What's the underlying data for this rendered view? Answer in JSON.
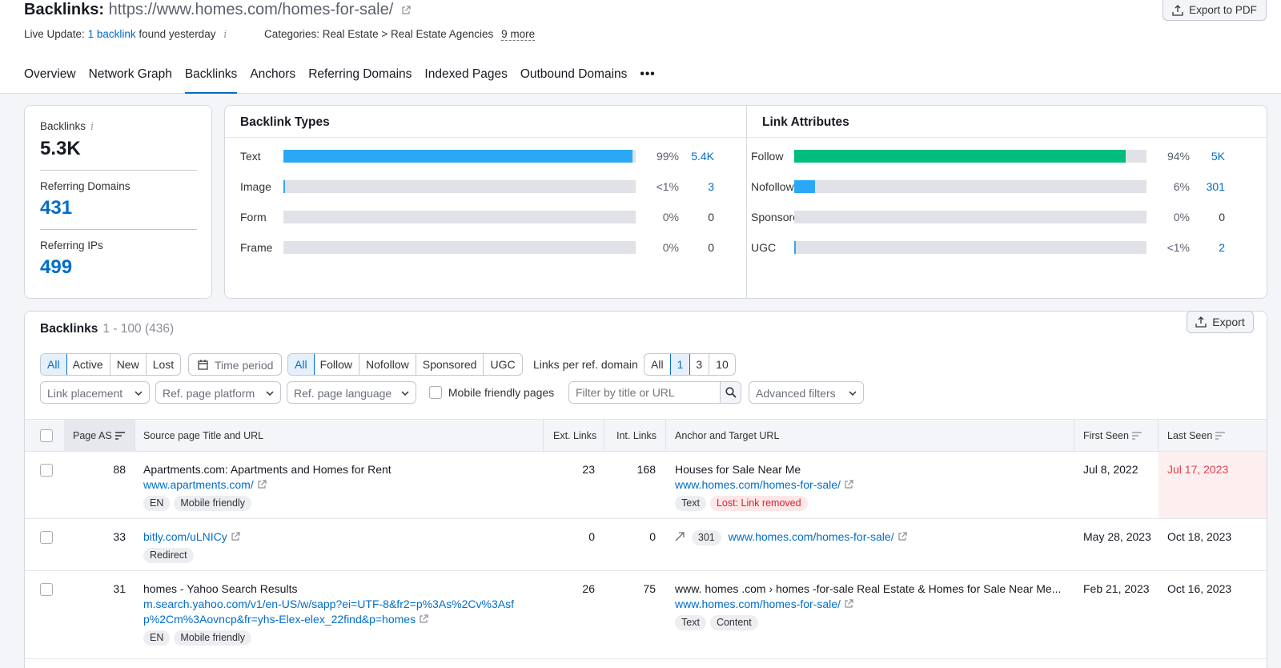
{
  "header": {
    "title_prefix": "Backlinks:",
    "title_url": "https://www.homes.com/homes-for-sale/",
    "live_label": "Live Update:",
    "live_link": "1 backlink",
    "live_suffix": "found yesterday",
    "categories_label": "Categories: Real Estate > Real Estate Agencies",
    "categories_more": "9 more",
    "export_pdf": "Export to PDF"
  },
  "tabs": [
    "Overview",
    "Network Graph",
    "Backlinks",
    "Anchors",
    "Referring Domains",
    "Indexed Pages",
    "Outbound Domains"
  ],
  "tabs_more": "•••",
  "stats": [
    {
      "label": "Backlinks",
      "value": "5.3K"
    },
    {
      "label": "Referring Domains",
      "value": "431"
    },
    {
      "label": "Referring IPs",
      "value": "499"
    }
  ],
  "backlink_types": {
    "title": "Backlink Types",
    "color": "#2ba8f5",
    "rows": [
      {
        "name": "Text",
        "fraction": 0.99,
        "pct": "99%",
        "count": "5.4K"
      },
      {
        "name": "Image",
        "fraction": 0.004,
        "pct": "<1%",
        "count": "3"
      },
      {
        "name": "Form",
        "fraction": 0,
        "pct": "0%",
        "count": "0"
      },
      {
        "name": "Frame",
        "fraction": 0,
        "pct": "0%",
        "count": "0"
      }
    ]
  },
  "link_attributes": {
    "title": "Link Attributes",
    "colors": {
      "follow": "#00bd7e",
      "other": "#2ba8f5"
    },
    "rows": [
      {
        "name": "Follow",
        "fraction": 0.94,
        "pct": "94%",
        "count": "5K"
      },
      {
        "name": "Nofollow",
        "fraction": 0.06,
        "pct": "6%",
        "count": "301"
      },
      {
        "name": "Sponsored",
        "fraction": 0,
        "pct": "0%",
        "count": "0"
      },
      {
        "name": "UGC",
        "fraction": 0.004,
        "pct": "<1%",
        "count": "2"
      }
    ]
  },
  "backlinks": {
    "title": "Backlinks",
    "range": "1 - 100 (436)",
    "export": "Export",
    "status_filter": [
      "All",
      "Active",
      "New",
      "Lost"
    ],
    "time_period": "Time period",
    "type_filter": [
      "All",
      "Follow",
      "Nofollow",
      "Sponsored",
      "UGC"
    ],
    "per_domain_label": "Links per ref. domain",
    "per_domain": [
      "All",
      "1",
      "3",
      "10"
    ],
    "link_placement": "Link placement",
    "ref_platform": "Ref. page platform",
    "ref_language": "Ref. page language",
    "mobile_friendly": "Mobile friendly pages",
    "search_placeholder": "Filter by title or URL",
    "advanced": "Advanced filters",
    "columns": {
      "page_as": "Page AS",
      "source": "Source page Title and URL",
      "ext": "Ext. Links",
      "int": "Int. Links",
      "anchor": "Anchor and Target URL",
      "first": "First Seen",
      "last": "Last Seen"
    },
    "rows": [
      {
        "as": "88",
        "title": "Apartments.com: Apartments and Homes for Rent",
        "url": "www.apartments.com/",
        "tags": [
          "EN",
          "Mobile friendly"
        ],
        "ext": "23",
        "int": "168",
        "anchor": "Houses for Sale Near Me",
        "target": "www.homes.com/homes-for-sale/",
        "anchor_tags": [
          "Text"
        ],
        "anchor_alert": "Lost: Link removed",
        "first": "Jul 8, 2022",
        "last": "Jul 17, 2023"
      },
      {
        "as": "33",
        "url": "bitly.com/uLNICy",
        "tags": [
          "Redirect"
        ],
        "ext": "0",
        "int": "0",
        "redirect_code": "301",
        "target": "www.homes.com/homes-for-sale/",
        "first": "May 28, 2023",
        "last": "Oct 18, 2023"
      },
      {
        "as": "31",
        "title": "homes - Yahoo Search Results",
        "url_line1": "m.search.yahoo.com/v1/en-US/w/sapp?ei=UTF-8&fr2=p%3As%2Cv%3Asf",
        "url_line2": "p%2Cm%3Aovncp&fr=yhs-Elex-elex_22find&p=homes",
        "tags": [
          "EN",
          "Mobile friendly"
        ],
        "ext": "26",
        "int": "75",
        "anchor": "www. homes .com › homes -for-sale Real Estate & Homes for Sale Near Me...",
        "target": "www.homes.com/homes-for-sale/",
        "anchor_tags": [
          "Text",
          "Content"
        ],
        "first": "Feb 21, 2023",
        "last": "Oct 16, 2023"
      }
    ]
  }
}
